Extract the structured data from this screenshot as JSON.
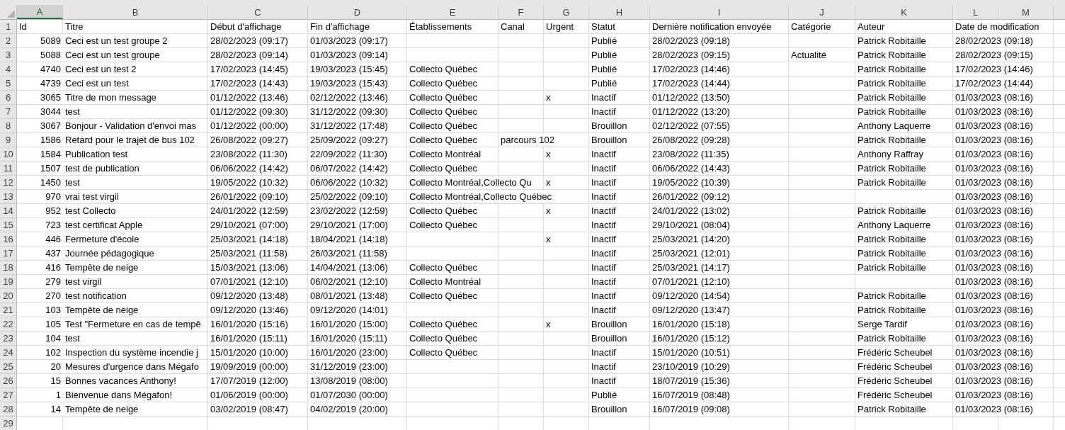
{
  "columns": [
    {
      "letter": "A",
      "kind": "number",
      "selected": true
    },
    {
      "letter": "B",
      "kind": "text",
      "selected": false
    },
    {
      "letter": "C",
      "kind": "text",
      "selected": false
    },
    {
      "letter": "D",
      "kind": "text",
      "selected": false
    },
    {
      "letter": "E",
      "kind": "text",
      "selected": false
    },
    {
      "letter": "F",
      "kind": "text",
      "selected": false
    },
    {
      "letter": "G",
      "kind": "text",
      "selected": false
    },
    {
      "letter": "H",
      "kind": "text",
      "selected": false
    },
    {
      "letter": "I",
      "kind": "text",
      "selected": false
    },
    {
      "letter": "J",
      "kind": "text",
      "selected": false
    },
    {
      "letter": "K",
      "kind": "text",
      "selected": false
    },
    {
      "letter": "L",
      "kind": "text",
      "selected": false
    },
    {
      "letter": "M",
      "kind": "text",
      "selected": false
    }
  ],
  "header_row": {
    "number": "1",
    "cells": {
      "A": "Id",
      "B": "Titre",
      "C": "Début d'affichage",
      "D": "Fin d'affichage",
      "E": "Établissements",
      "F": "Canal",
      "G": "Urgent",
      "H": "Statut",
      "I": "Dernière notification envoyée",
      "J": "Catégorie",
      "K": "Auteur",
      "L": "Date de modification"
    }
  },
  "rows": [
    {
      "number": "2",
      "cells": {
        "A": "5089",
        "B": "Ceci est un test groupe 2",
        "C": "28/02/2023 (09:17)",
        "D": "01/03/2023 (09:17)",
        "H": "Publié",
        "I": "28/02/2023 (09:18)",
        "K": "Patrick Robitaille",
        "L": "28/02/2023 (09:18)"
      }
    },
    {
      "number": "3",
      "cells": {
        "A": "5088",
        "B": "Ceci est un test groupe",
        "C": "28/02/2023 (09:14)",
        "D": "01/03/2023 (09:14)",
        "H": "Publié",
        "I": "28/02/2023 (09:15)",
        "J": "Actualité",
        "K": "Patrick Robitaille",
        "L": "28/02/2023 (09:15)"
      }
    },
    {
      "number": "4",
      "cells": {
        "A": "4740",
        "B": "Ceci est un test 2",
        "C": "17/02/2023 (14:45)",
        "D": "19/03/2023 (15:45)",
        "E": "Collecto Québec",
        "H": "Publié",
        "I": "17/02/2023 (14:46)",
        "K": "Patrick Robitaille",
        "L": "17/02/2023 (14:46)"
      }
    },
    {
      "number": "5",
      "cells": {
        "A": "4739",
        "B": "Ceci est un test",
        "C": "17/02/2023 (14:43)",
        "D": "19/03/2023 (15:43)",
        "E": "Collecto Québec",
        "H": "Publié",
        "I": "17/02/2023 (14:44)",
        "K": "Patrick Robitaille",
        "L": "17/02/2023 (14:44)"
      }
    },
    {
      "number": "6",
      "cells": {
        "A": "3065",
        "B": "Titre de mon message",
        "C": "01/12/2022 (13:46)",
        "D": "02/12/2022 (13:46)",
        "E": "Collecto Québec",
        "G": "x",
        "H": "Inactif",
        "I": "01/12/2022 (13:50)",
        "K": "Patrick Robitaille",
        "L": "01/03/2023 (08:16)"
      }
    },
    {
      "number": "7",
      "cells": {
        "A": "3044",
        "B": "test",
        "C": "01/12/2022 (09:30)",
        "D": "31/12/2022 (09:30)",
        "E": "Collecto Québec",
        "H": "Inactif",
        "I": "01/12/2022 (13:20)",
        "K": "Patrick Robitaille",
        "L": "01/03/2023 (08:16)"
      }
    },
    {
      "number": "8",
      "cells": {
        "A": "3067",
        "B": "Bonjour - Validation d'envoi mas",
        "C": "01/12/2022 (00:00)",
        "D": "31/12/2022 (17:48)",
        "E": "Collecto Québec",
        "H": "Brouillon",
        "I": "02/12/2022 (07:55)",
        "K": "Anthony Laquerre",
        "L": "01/03/2023 (08:16)"
      }
    },
    {
      "number": "9",
      "cells": {
        "A": "1586",
        "B": "Retard pour le trajet de bus 102",
        "C": "26/08/2022 (09:27)",
        "D": "25/09/2022 (09:27)",
        "E": "Collecto Québec",
        "F": "parcours 102",
        "H": "Brouillon",
        "I": "26/08/2022 (09:28)",
        "K": "Patrick Robitaille",
        "L": "01/03/2023 (08:16)"
      }
    },
    {
      "number": "10",
      "cells": {
        "A": "1584",
        "B": "Publication test",
        "C": "23/08/2022 (11:30)",
        "D": "22/09/2022 (11:30)",
        "E": "Collecto Montréal",
        "G": "x",
        "H": "Inactif",
        "I": "23/08/2022 (11:35)",
        "K": "Anthony Raffray",
        "L": "01/03/2023 (08:16)"
      }
    },
    {
      "number": "11",
      "cells": {
        "A": "1507",
        "B": "test de publication",
        "C": "06/06/2022 (14:42)",
        "D": "06/07/2022 (14:42)",
        "E": "Collecto Québec",
        "H": "Inactif",
        "I": "06/06/2022 (14:43)",
        "K": "Patrick Robitaille",
        "L": "01/03/2023 (08:16)"
      }
    },
    {
      "number": "12",
      "cells": {
        "A": "1450",
        "B": "test",
        "C": "19/05/2022 (10:32)",
        "D": "06/06/2022 (10:32)",
        "E": "Collecto Montréal,Collecto Qu",
        "G": "x",
        "H": "Inactif",
        "I": "19/05/2022 (10:39)",
        "K": "Patrick Robitaille",
        "L": "01/03/2023 (08:16)"
      }
    },
    {
      "number": "13",
      "cells": {
        "A": "970",
        "B": "vrai test virgil",
        "C": "26/01/2022 (09:10)",
        "D": "25/02/2022 (09:10)",
        "E": "Collecto Montréal,Collecto Québec",
        "H": "Inactif",
        "I": "26/01/2022 (09:12)",
        "L": "01/03/2023 (08:16)"
      }
    },
    {
      "number": "14",
      "cells": {
        "A": "952",
        "B": "test Collecto",
        "C": "24/01/2022 (12:59)",
        "D": "23/02/2022 (12:59)",
        "E": "Collecto Québec",
        "G": "x",
        "H": "Inactif",
        "I": "24/01/2022 (13:02)",
        "K": "Patrick Robitaille",
        "L": "01/03/2023 (08:16)"
      }
    },
    {
      "number": "15",
      "cells": {
        "A": "723",
        "B": "test certificat Apple",
        "C": "29/10/2021 (07:00)",
        "D": "29/10/2021 (17:00)",
        "E": "Collecto Québec",
        "H": "Inactif",
        "I": "29/10/2021 (08:04)",
        "K": "Anthony Laquerre",
        "L": "01/03/2023 (08:16)"
      }
    },
    {
      "number": "16",
      "cells": {
        "A": "446",
        "B": "Fermeture d'école",
        "C": "25/03/2021 (14:18)",
        "D": "18/04/2021 (14:18)",
        "G": "x",
        "H": "Inactif",
        "I": "25/03/2021 (14:20)",
        "K": "Patrick Robitaille",
        "L": "01/03/2023 (08:16)"
      }
    },
    {
      "number": "17",
      "cells": {
        "A": "437",
        "B": "Journée pédagogique",
        "C": "25/03/2021 (11:58)",
        "D": "26/03/2021 (11:58)",
        "H": "Inactif",
        "I": "25/03/2021 (12:01)",
        "K": "Patrick Robitaille",
        "L": "01/03/2023 (08:16)"
      }
    },
    {
      "number": "18",
      "cells": {
        "A": "416",
        "B": "Tempête de neige",
        "C": "15/03/2021 (13:06)",
        "D": "14/04/2021 (13:06)",
        "E": "Collecto Québec",
        "H": "Inactif",
        "I": "25/03/2021 (14:17)",
        "K": "Patrick Robitaille",
        "L": "01/03/2023 (08:16)"
      }
    },
    {
      "number": "19",
      "cells": {
        "A": "279",
        "B": "test virgil",
        "C": "07/01/2021 (12:10)",
        "D": "06/02/2021 (12:10)",
        "E": "Collecto Montréal",
        "H": "Inactif",
        "I": "07/01/2021 (12:10)",
        "L": "01/03/2023 (08:16)"
      }
    },
    {
      "number": "20",
      "cells": {
        "A": "270",
        "B": "test notification",
        "C": "09/12/2020 (13:48)",
        "D": "08/01/2021 (13:48)",
        "E": "Collecto Québec",
        "H": "Inactif",
        "I": "09/12/2020 (14:54)",
        "K": "Patrick Robitaille",
        "L": "01/03/2023 (08:16)"
      }
    },
    {
      "number": "21",
      "cells": {
        "A": "103",
        "B": "Tempête de neige",
        "C": "09/12/2020 (13:46)",
        "D": "09/12/2020 (14:01)",
        "H": "Inactif",
        "I": "09/12/2020 (13:47)",
        "K": "Patrick Robitaille",
        "L": "01/03/2023 (08:16)"
      }
    },
    {
      "number": "22",
      "cells": {
        "A": "105",
        "B": "Test \"Fermeture en cas de tempê",
        "C": "16/01/2020 (15:16)",
        "D": "16/01/2020 (15:00)",
        "E": "Collecto Québec",
        "G": "x",
        "H": "Brouillon",
        "I": "16/01/2020 (15:18)",
        "K": "Serge Tardif",
        "L": "01/03/2023 (08:16)"
      }
    },
    {
      "number": "23",
      "cells": {
        "A": "104",
        "B": "test",
        "C": "16/01/2020 (15:11)",
        "D": "16/01/2020 (15:11)",
        "E": "Collecto Québec",
        "H": "Brouillon",
        "I": "16/01/2020 (15:12)",
        "K": "Patrick Robitaille",
        "L": "01/03/2023 (08:16)"
      }
    },
    {
      "number": "24",
      "cells": {
        "A": "102",
        "B": "Inspection du système incendie j",
        "C": "15/01/2020 (10:00)",
        "D": "16/01/2020 (23:00)",
        "E": "Collecto Québec",
        "H": "Inactif",
        "I": "15/01/2020 (10:51)",
        "K": "Frédéric Scheubel",
        "L": "01/03/2023 (08:16)"
      }
    },
    {
      "number": "25",
      "cells": {
        "A": "20",
        "B": "Mesures d'urgence dans Mégafo",
        "C": "19/09/2019 (00:00)",
        "D": "31/12/2019 (23:00)",
        "H": "Inactif",
        "I": "23/10/2019 (10:29)",
        "K": "Frédéric Scheubel",
        "L": "01/03/2023 (08:16)"
      }
    },
    {
      "number": "26",
      "cells": {
        "A": "15",
        "B": "Bonnes vacances Anthony!",
        "C": "17/07/2019 (12:00)",
        "D": "13/08/2019 (08:00)",
        "H": "Inactif",
        "I": "18/07/2019 (15:36)",
        "K": "Frédéric Scheubel",
        "L": "01/03/2023 (08:16)"
      }
    },
    {
      "number": "27",
      "cells": {
        "A": "1",
        "B": "Bienvenue dans Mégafon!",
        "C": "01/06/2019 (00:00)",
        "D": "01/07/2030 (00:00)",
        "H": "Publié",
        "I": "16/07/2019 (08:48)",
        "K": "Frédéric Scheubel",
        "L": "01/03/2023 (08:16)"
      }
    },
    {
      "number": "28",
      "cells": {
        "A": "14",
        "B": "Tempête de neige",
        "C": "03/02/2019 (08:47)",
        "D": "04/02/2019 (20:00)",
        "H": "Brouillon",
        "I": "16/07/2019 (09:08)",
        "K": "Patrick Robitaille",
        "L": "01/03/2023 (08:16)"
      }
    },
    {
      "number": "29"
    }
  ]
}
